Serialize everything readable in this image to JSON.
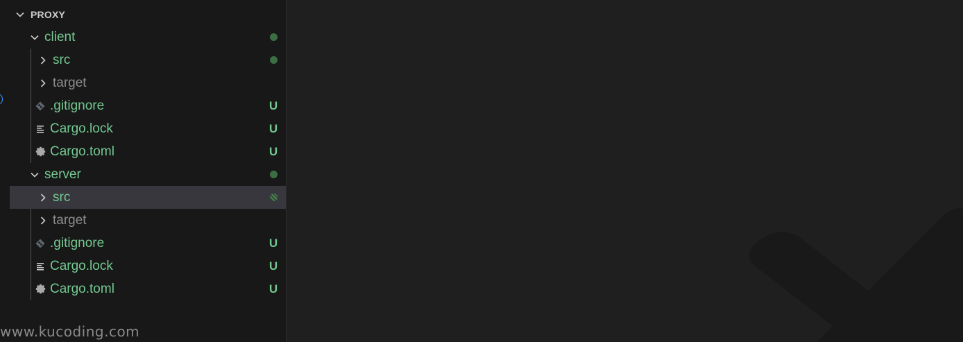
{
  "explorer": {
    "section_title": "PROXY",
    "tree": [
      {
        "name": "client",
        "kind": "folder-open",
        "color": "green",
        "status": "dot"
      },
      {
        "name": "src",
        "kind": "folder-closed",
        "color": "green",
        "status": "dot"
      },
      {
        "name": "target",
        "kind": "folder-closed",
        "color": "grey",
        "status": ""
      },
      {
        "name": ".gitignore",
        "kind": "git-file",
        "color": "green",
        "status": "U"
      },
      {
        "name": "Cargo.lock",
        "kind": "lines-file",
        "color": "green",
        "status": "U"
      },
      {
        "name": "Cargo.toml",
        "kind": "gear-file",
        "color": "green",
        "status": "U"
      },
      {
        "name": "server",
        "kind": "folder-open",
        "color": "green",
        "status": "dot"
      },
      {
        "name": "src",
        "kind": "folder-closed",
        "color": "green",
        "status": "dot-hatched",
        "selected": true
      },
      {
        "name": "target",
        "kind": "folder-closed",
        "color": "grey",
        "status": ""
      },
      {
        "name": ".gitignore",
        "kind": "git-file",
        "color": "green",
        "status": "U"
      },
      {
        "name": "Cargo.lock",
        "kind": "lines-file",
        "color": "green",
        "status": "U"
      },
      {
        "name": "Cargo.toml",
        "kind": "gear-file",
        "color": "green",
        "status": "U"
      }
    ]
  },
  "watermark": "www.kucoding.com",
  "colors": {
    "untracked": "#73c991",
    "ignored": "#8c8c8c",
    "selection": "#37373d",
    "sidebar": "#181818",
    "editor": "#1f1f1f"
  }
}
